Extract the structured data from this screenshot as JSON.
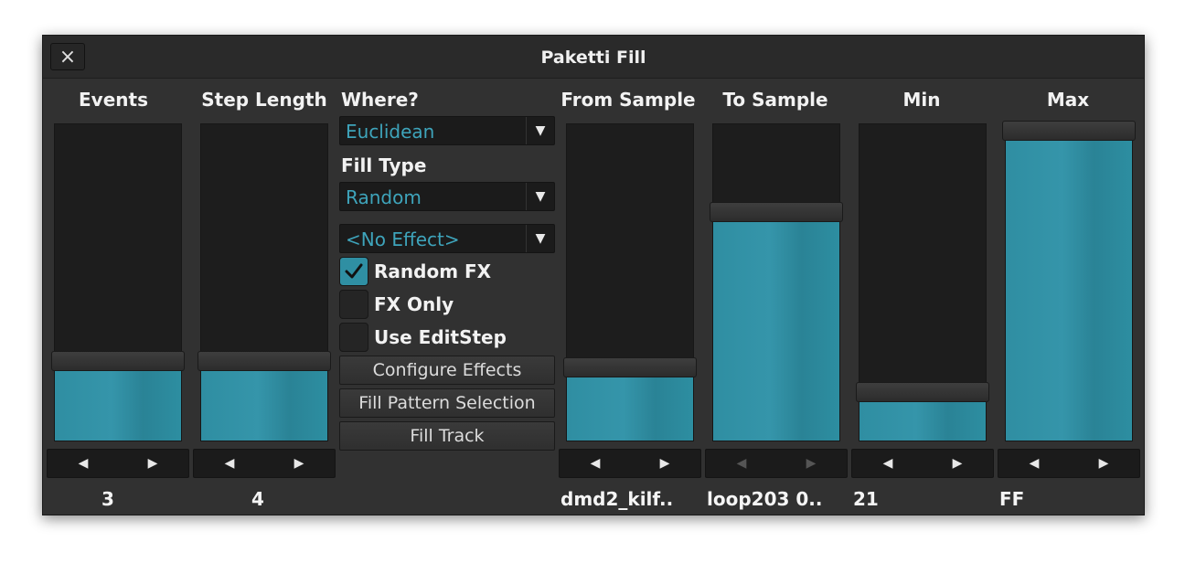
{
  "window": {
    "title": "Paketti Fill",
    "close_icon": "×"
  },
  "columns": [
    {
      "header": "Events",
      "level": 0.22,
      "value": "3"
    },
    {
      "header": "Step Length",
      "level": 0.22,
      "value": "4"
    },
    {
      "header": "From Sample",
      "level": 0.2,
      "value": "dmd2_kilf.."
    },
    {
      "header": "To Sample",
      "level": 0.69,
      "value": "loop203 0.."
    },
    {
      "header": "Min",
      "level": 0.12,
      "value": "21"
    },
    {
      "header": "Max",
      "level": 1.0,
      "value": "FF"
    }
  ],
  "middle": {
    "where_label": "Where?",
    "where_value": "Euclidean",
    "fill_type_label": "Fill Type",
    "fill_type_value": "Random",
    "effect_value": "<No Effect>",
    "random_fx_label": "Random FX",
    "random_fx_checked": true,
    "fx_only_label": "FX Only",
    "fx_only_checked": false,
    "use_editstep_label": "Use EditStep",
    "use_editstep_checked": false,
    "configure_effects_label": "Configure Effects",
    "fill_pattern_selection_label": "Fill Pattern Selection",
    "fill_track_label": "Fill Track"
  },
  "icons": {
    "arrow_left": "◀",
    "arrow_right": "▶",
    "dropdown_arrow": "▼"
  },
  "colors": {
    "accent": "#2f8ea2",
    "accent_text": "#3ea4bb",
    "background": "#313131",
    "track": "#1d1d1d"
  }
}
